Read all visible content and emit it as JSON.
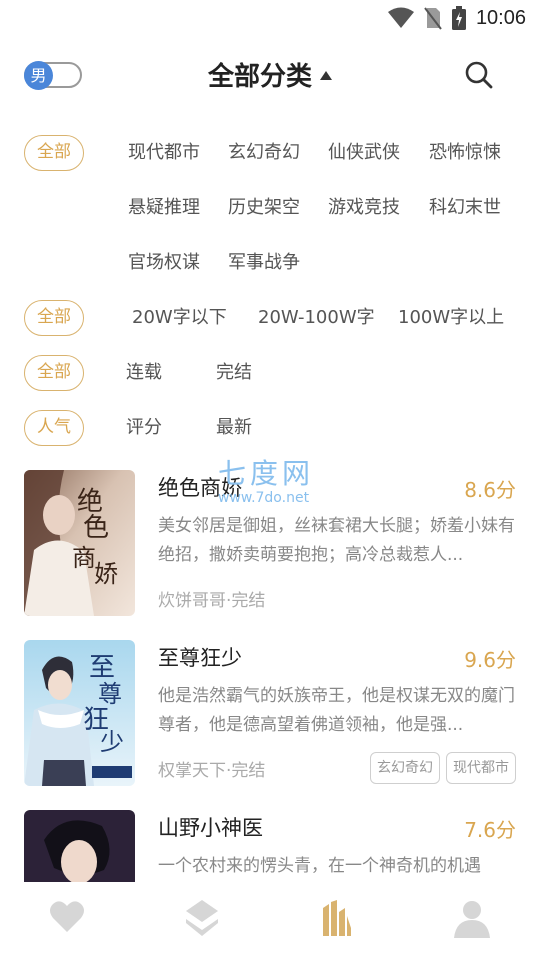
{
  "status_bar": {
    "time": "10:06"
  },
  "header": {
    "gender_label": "男",
    "title": "全部分类"
  },
  "filters": {
    "category": {
      "selected": "全部",
      "options": [
        "现代都市",
        "玄幻奇幻",
        "仙侠武侠",
        "恐怖惊悚",
        "悬疑推理",
        "历史架空",
        "游戏竞技",
        "科幻末世",
        "官场权谋",
        "军事战争"
      ]
    },
    "word_count": {
      "selected": "全部",
      "options": [
        "20W字以下",
        "20W-100W字",
        "100W字以上"
      ]
    },
    "status": {
      "selected": "全部",
      "options": [
        "连载",
        "完结"
      ]
    },
    "sort": {
      "selected": "人气",
      "options": [
        "评分",
        "最新"
      ]
    }
  },
  "books": [
    {
      "title": "绝色商娇",
      "score": "8.6分",
      "description": "美女邻居是御姐，丝袜套裙大长腿；娇羞小妹有绝招，撒娇卖萌要抱抱；高冷总裁惹人...",
      "meta": "炊饼哥哥·完结",
      "tags": [],
      "cover_text": "绝色商娇"
    },
    {
      "title": "至尊狂少",
      "score": "9.6分",
      "description": "他是浩然霸气的妖族帝王，他是权谋无双的魔门尊者，他是德高望着佛道领袖，他是强...",
      "meta": "权掌天下·完结",
      "tags": [
        "玄幻奇幻",
        "现代都市"
      ],
      "cover_text": "至尊狂少"
    },
    {
      "title": "山野小神医",
      "score": "7.6分",
      "description": "一个农村来的愣头青，在一个神奇机的机遇",
      "meta": "",
      "tags": []
    }
  ],
  "watermark": {
    "big": "七度网",
    "small": "www.7do.net"
  },
  "colors": {
    "accent": "#d9a650",
    "toggle": "#4a86d9",
    "nav_active": "#d9b36f",
    "nav_inactive": "#d6d6d6"
  },
  "nav": [
    "heart-icon",
    "layers-icon",
    "bookshelf-icon",
    "user-icon"
  ]
}
